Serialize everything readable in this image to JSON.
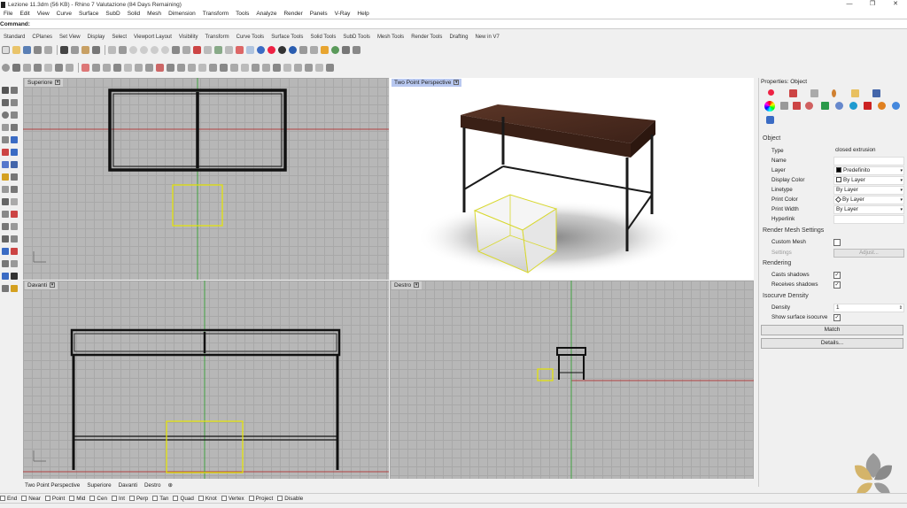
{
  "window": {
    "title": "Lezione 11.3dm (56 KB) - Rhino 7 Valutazione (84 Days Remaining)",
    "minimize": "—",
    "restore": "❐",
    "close": "✕"
  },
  "menu": [
    "File",
    "Edit",
    "View",
    "Curve",
    "Surface",
    "SubD",
    "Solid",
    "Mesh",
    "Dimension",
    "Transform",
    "Tools",
    "Analyze",
    "Render",
    "Panels",
    "V-Ray",
    "Help"
  ],
  "command": {
    "label": "Command:",
    "value": ""
  },
  "tabs": [
    "Standard",
    "CPlanes",
    "Set View",
    "Display",
    "Select",
    "Viewport Layout",
    "Visibility",
    "Transform",
    "Curve Tools",
    "Surface Tools",
    "Solid Tools",
    "SubD Tools",
    "Mesh Tools",
    "Render Tools",
    "Drafting",
    "New in V7"
  ],
  "viewports": {
    "top": "Superiore",
    "perspective": "Two Point Perspective",
    "front": "Davanti",
    "right": "Destro"
  },
  "viewport_tabs": [
    "Two Point Perspective",
    "Superiore",
    "Davanti",
    "Destro",
    "⊕"
  ],
  "properties": {
    "panel_title": "Properties: Object",
    "object_header": "Object",
    "rows": [
      {
        "k": "Type",
        "v": "closed extrusion"
      },
      {
        "k": "Name",
        "v": ""
      },
      {
        "k": "Layer",
        "v": "Predefinito"
      },
      {
        "k": "Display Color",
        "v": "By Layer"
      },
      {
        "k": "Linetype",
        "v": "By Layer"
      },
      {
        "k": "Print Color",
        "v": "By Layer"
      },
      {
        "k": "Print Width",
        "v": "By Layer"
      },
      {
        "k": "Hyperlink",
        "v": ""
      }
    ],
    "render_mesh": "Render Mesh Settings",
    "custom_mesh": "Custom Mesh",
    "settings": "Settings",
    "adjust": "Adjust...",
    "rendering": "Rendering",
    "casts_shadows": "Casts shadows",
    "receives_shadows": "Receives shadows",
    "isocurve_density": "Isocurve Density",
    "density": "Density",
    "density_value": "1",
    "show_isocurve": "Show surface isocurve",
    "match": "Match",
    "details": "Details..."
  },
  "snaps": [
    "End",
    "Near",
    "Point",
    "Mid",
    "Cen",
    "Int",
    "Perp",
    "Tan",
    "Quad",
    "Knot",
    "Vertex",
    "Project",
    "Disable"
  ],
  "colors": {
    "wood": "#4a2a1e",
    "selection": "#e6e600",
    "x_axis": "#b04040",
    "y_axis": "#40a040"
  }
}
